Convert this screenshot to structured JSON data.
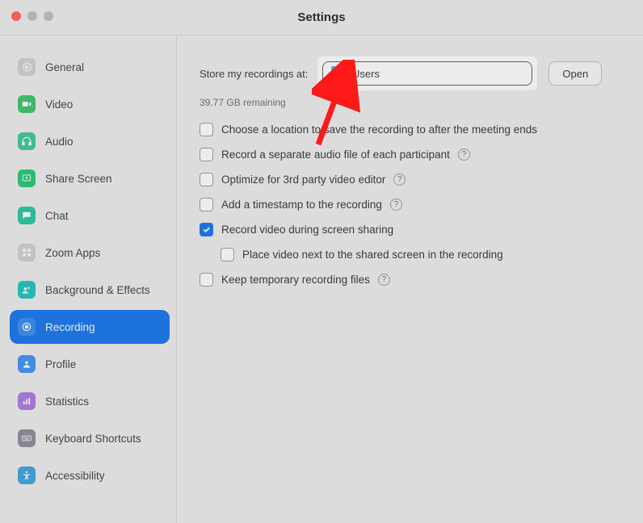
{
  "window": {
    "title": "Settings"
  },
  "sidebar": {
    "items": [
      {
        "label": "General",
        "icon": "gear-icon"
      },
      {
        "label": "Video",
        "icon": "video-icon"
      },
      {
        "label": "Audio",
        "icon": "headphones-icon"
      },
      {
        "label": "Share Screen",
        "icon": "share-screen-icon"
      },
      {
        "label": "Chat",
        "icon": "chat-icon"
      },
      {
        "label": "Zoom Apps",
        "icon": "apps-icon"
      },
      {
        "label": "Background & Effects",
        "icon": "background-effects-icon"
      },
      {
        "label": "Recording",
        "icon": "record-icon",
        "selected": true
      },
      {
        "label": "Profile",
        "icon": "profile-icon"
      },
      {
        "label": "Statistics",
        "icon": "statistics-icon"
      },
      {
        "label": "Keyboard Shortcuts",
        "icon": "keyboard-icon"
      },
      {
        "label": "Accessibility",
        "icon": "accessibility-icon"
      }
    ]
  },
  "main": {
    "location_label": "Store my recordings at:",
    "path_value": "/Users",
    "open_label": "Open",
    "remaining": "39.77 GB remaining",
    "options": [
      {
        "label": "Choose a location to save the recording to after the meeting ends",
        "checked": false,
        "help": false
      },
      {
        "label": "Record a separate audio file of each participant",
        "checked": false,
        "help": true
      },
      {
        "label": "Optimize for 3rd party video editor",
        "checked": false,
        "help": true
      },
      {
        "label": "Add a timestamp to the recording",
        "checked": false,
        "help": true
      },
      {
        "label": "Record video during screen sharing",
        "checked": true,
        "help": false
      },
      {
        "label": "Place video next to the shared screen in the recording",
        "checked": false,
        "help": false,
        "indent": true
      },
      {
        "label": "Keep temporary recording files",
        "checked": false,
        "help": true
      }
    ]
  }
}
